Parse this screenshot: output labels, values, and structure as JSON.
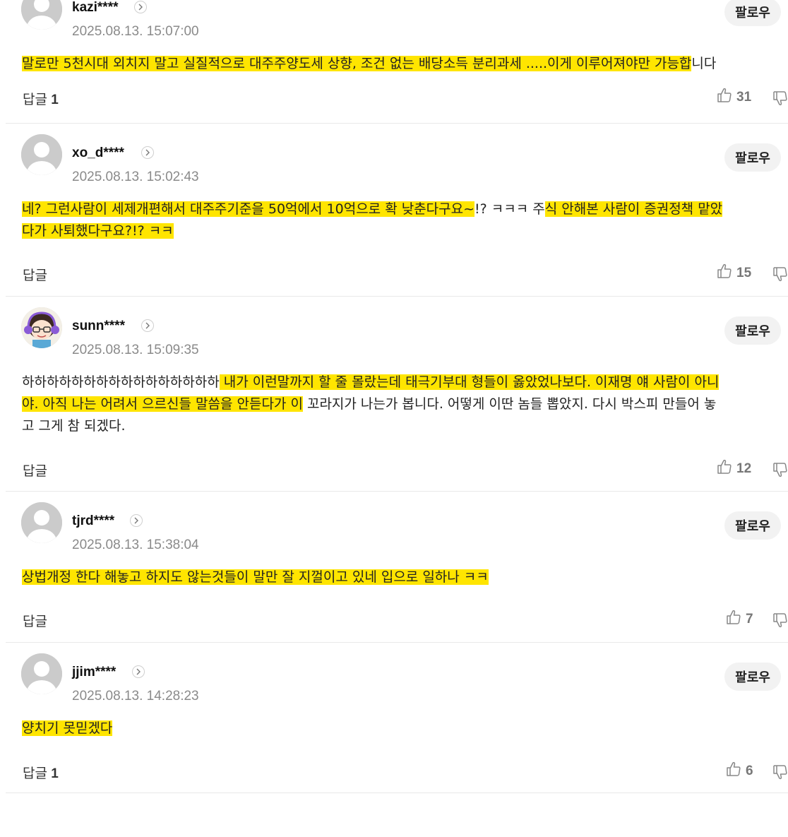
{
  "follow_label": "팔로우",
  "reply_label": "답글",
  "comments": [
    {
      "user": "kazi****",
      "date": "2025.08.13. 15:07:00",
      "lines": [
        [
          {
            "t": "말로만 5천시대 외치지 말고 실질적으로 대주주양도세 상향, 조건 없는 배당소득 분리과세 .....이게 이루어져야만 가능합",
            "h": true
          },
          {
            "t": "니다",
            "h": false
          }
        ]
      ],
      "reply_count": "1",
      "likes": "31"
    },
    {
      "user": "xo_d****",
      "date": "2025.08.13. 15:02:43",
      "lines": [
        [
          {
            "t": "네? 그런사람이 세제개편해서 대주주기준을 50억에서 10억으로 확 낮춘다구요~",
            "h": true
          },
          {
            "t": "!? ㅋㅋㅋ 주",
            "h": false
          },
          {
            "t": "식 안해본 사람이 증권정책 맡았",
            "h": true
          }
        ],
        [
          {
            "t": "다가 사퇴했다구요?!? ㅋㅋ",
            "h": true
          }
        ]
      ],
      "reply_count": "",
      "likes": "15"
    },
    {
      "user": "sunn****",
      "date": "2025.08.13. 15:09:35",
      "lines": [
        [
          {
            "t": "하하하하하하하하하하하하하하하하",
            "h": false
          },
          {
            "t": " 내가 이런말까지 할 줄 몰랐는데 태극기부대 형들이 옳았었나보다. 이재명 얘 사람이 아니",
            "h": true
          }
        ],
        [
          {
            "t": "야. 아직 나는 어려서 으르신들 말씀을 안듣다가 이",
            "h": true
          },
          {
            "t": " 꼬라지가 나는가 봅니다. 어떻게 이딴 놈들 뽑았지. 다시 박스피 만들어 놓",
            "h": false
          }
        ],
        [
          {
            "t": "고 그게 참 되겠다.",
            "h": false
          }
        ]
      ],
      "reply_count": "",
      "likes": "12"
    },
    {
      "user": "tjrd****",
      "date": "2025.08.13. 15:38:04",
      "lines": [
        [
          {
            "t": "상법개정 한다 해놓고 하지도 않는것들이 말만 잘 지껄이고 있네 입으로 일하나 ㅋㅋ",
            "h": true
          }
        ]
      ],
      "reply_count": "",
      "likes": "7"
    },
    {
      "user": "jjim****",
      "date": "2025.08.13. 14:28:23",
      "lines": [
        [
          {
            "t": "양치기 못믿겠다",
            "h": true
          }
        ]
      ],
      "reply_count": "1",
      "likes": "6"
    }
  ]
}
